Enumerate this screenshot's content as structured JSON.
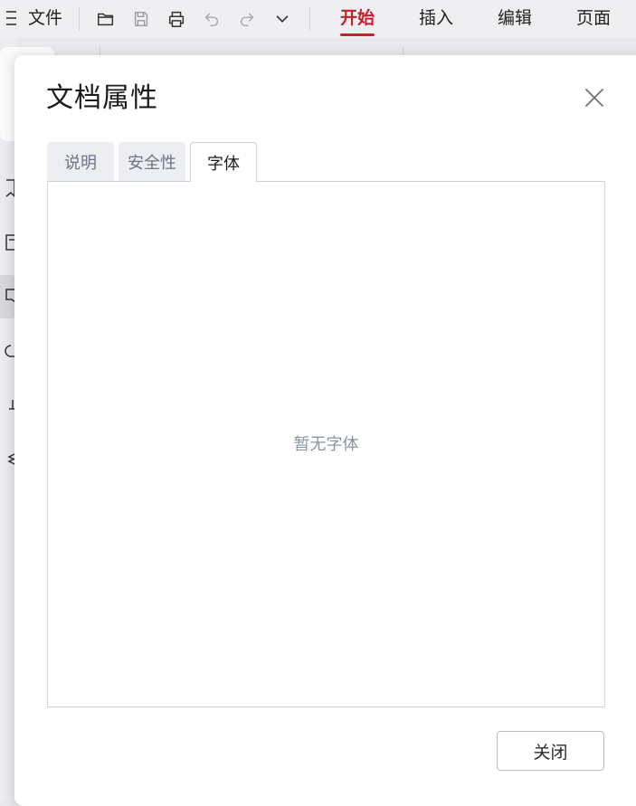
{
  "toolbar": {
    "file_label": "文件",
    "tabs": [
      {
        "label": "开始",
        "active": true
      },
      {
        "label": "插入",
        "active": false
      },
      {
        "label": "编辑",
        "active": false
      },
      {
        "label": "页面",
        "active": false
      }
    ],
    "icons": [
      "menu-icon",
      "open-folder-icon",
      "save-icon",
      "print-icon",
      "undo-icon",
      "redo-icon",
      "chevron-down-icon"
    ],
    "accent_color": "#c4202e"
  },
  "dialog": {
    "title": "文档属性",
    "tabs": [
      {
        "label": "说明",
        "active": false
      },
      {
        "label": "安全性",
        "active": false
      },
      {
        "label": "字体",
        "active": true
      }
    ],
    "empty_message": "暂无字体",
    "close_button_label": "关闭"
  }
}
